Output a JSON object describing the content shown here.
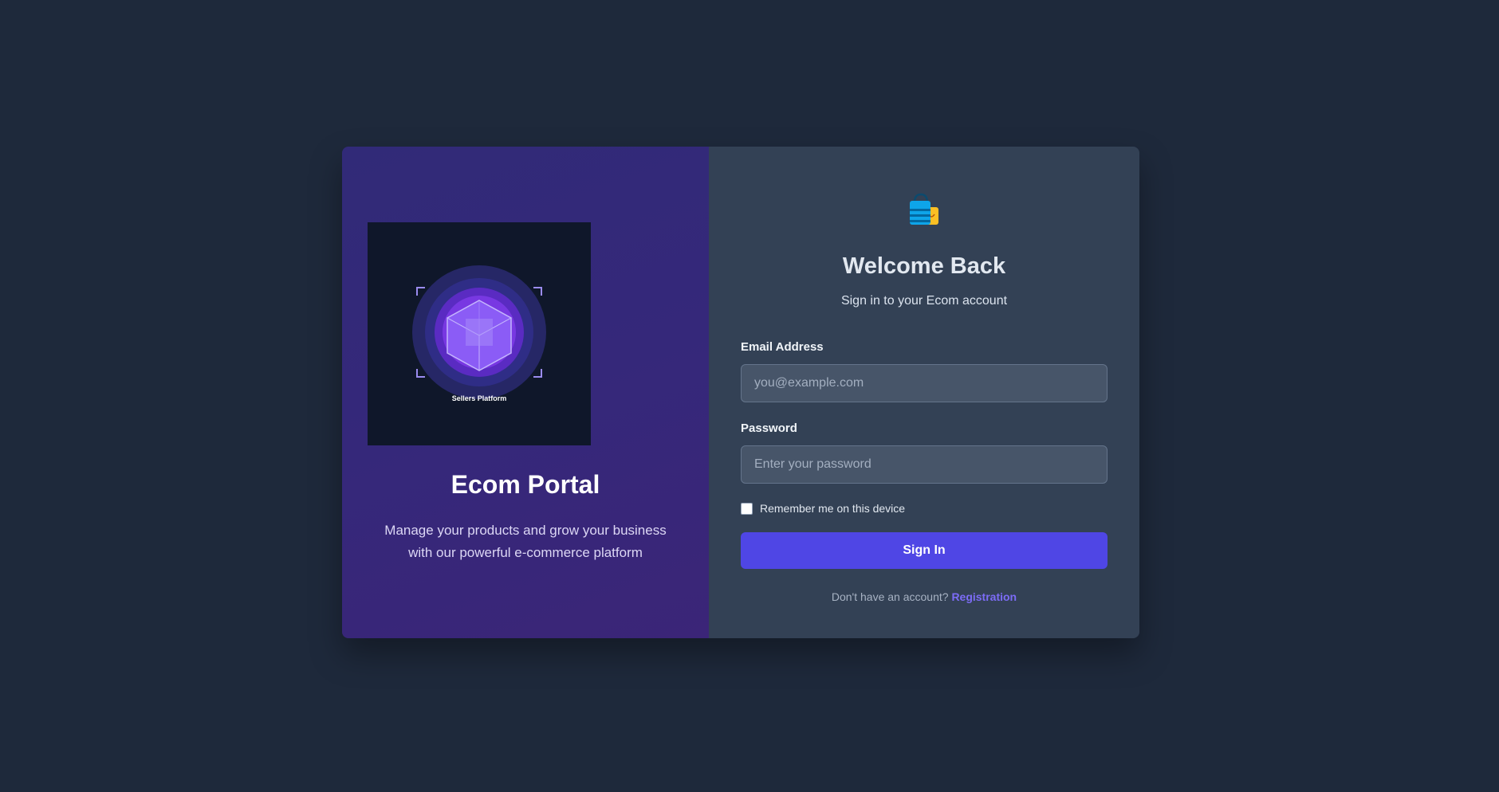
{
  "brand": {
    "logo_caption": "Sellers Platform",
    "title": "Ecom Portal",
    "description": "Manage your products and grow your business with our powerful e-commerce platform"
  },
  "login": {
    "icon": "shopping-bags-icon",
    "title": "Welcome Back",
    "subtitle": "Sign in to your Ecom account",
    "email_label": "Email Address",
    "email_placeholder": "you@example.com",
    "email_value": "",
    "password_label": "Password",
    "password_placeholder": "Enter your password",
    "password_value": "",
    "remember_label": "Remember me on this device",
    "remember_checked": false,
    "submit_label": "Sign In",
    "no_account_text": "Don't have an account?",
    "register_link": "Registration"
  },
  "colors": {
    "page_background": "#1e293b",
    "form_panel": "#334155",
    "accent": "#4f46e5",
    "link": "#7c6cf6"
  }
}
